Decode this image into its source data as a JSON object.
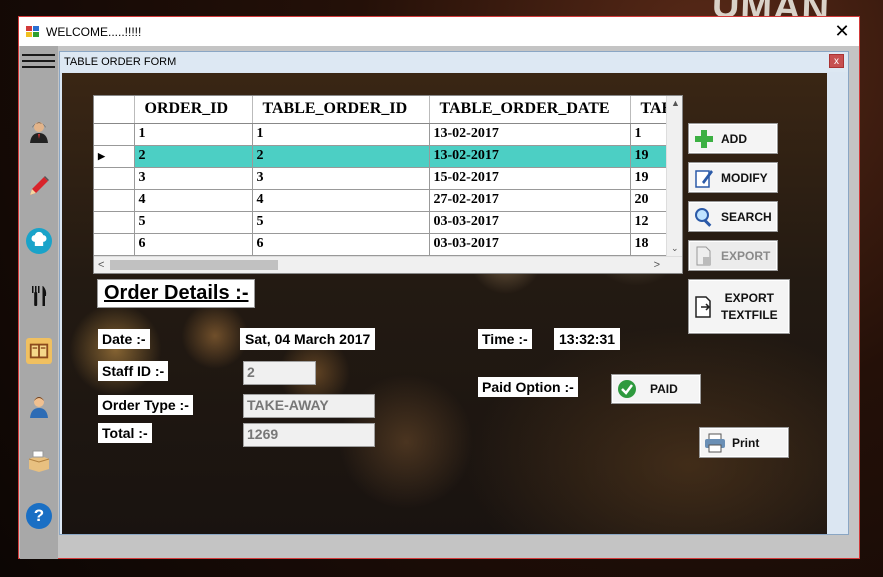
{
  "desktop": {
    "background_text": "UMAN"
  },
  "main_window": {
    "title": "WELCOME.....!!!!!",
    "close_label": "✕"
  },
  "sidebar": {
    "items": [
      {
        "name": "user-icon"
      },
      {
        "name": "pencil-icon"
      },
      {
        "name": "chef-hat-icon"
      },
      {
        "name": "cutlery-icon"
      },
      {
        "name": "menu-card-icon"
      },
      {
        "name": "staff-icon"
      },
      {
        "name": "printer-box-icon"
      },
      {
        "name": "help-icon"
      }
    ]
  },
  "child_window": {
    "title": "TABLE ORDER FORM",
    "close_label": "x"
  },
  "grid": {
    "columns": [
      "ORDER_ID",
      "TABLE_ORDER_ID",
      "TABLE_ORDER_DATE",
      "TAB"
    ],
    "rows": [
      [
        "1",
        "1",
        "13-02-2017",
        "1"
      ],
      [
        "2",
        "2",
        "13-02-2017",
        "19"
      ],
      [
        "3",
        "3",
        "15-02-2017",
        "19"
      ],
      [
        "4",
        "4",
        "27-02-2017",
        "20"
      ],
      [
        "5",
        "5",
        "03-03-2017",
        "12"
      ],
      [
        "6",
        "6",
        "03-03-2017",
        "18"
      ]
    ],
    "selected_row_marker": "▶",
    "scroll_up": "▲",
    "scroll_down": "⌄",
    "scroll_left": "<",
    "scroll_right": ">"
  },
  "actions": {
    "add": "ADD",
    "modify": "MODIFY",
    "search": "SEARCH",
    "export": "EXPORT",
    "export_textfile_line1": "EXPORT",
    "export_textfile_line2": "TEXTFILE",
    "paid": "PAID",
    "print": "Print"
  },
  "details": {
    "heading": "Order Details :-",
    "date_label": "Date :-",
    "date_value": "Sat, 04 March 2017",
    "time_label": "Time :-",
    "time_value": "13:32:31",
    "staff_label": "Staff ID :-",
    "staff_value": "2",
    "order_type_label": "Order Type :-",
    "order_type_value": "TAKE-AWAY",
    "total_label": "Total :-",
    "total_value": "1269",
    "paid_option_label": "Paid Option :-"
  },
  "colors": {
    "selected_row": "#4ccfc4",
    "window_border": "#d23a3a"
  }
}
